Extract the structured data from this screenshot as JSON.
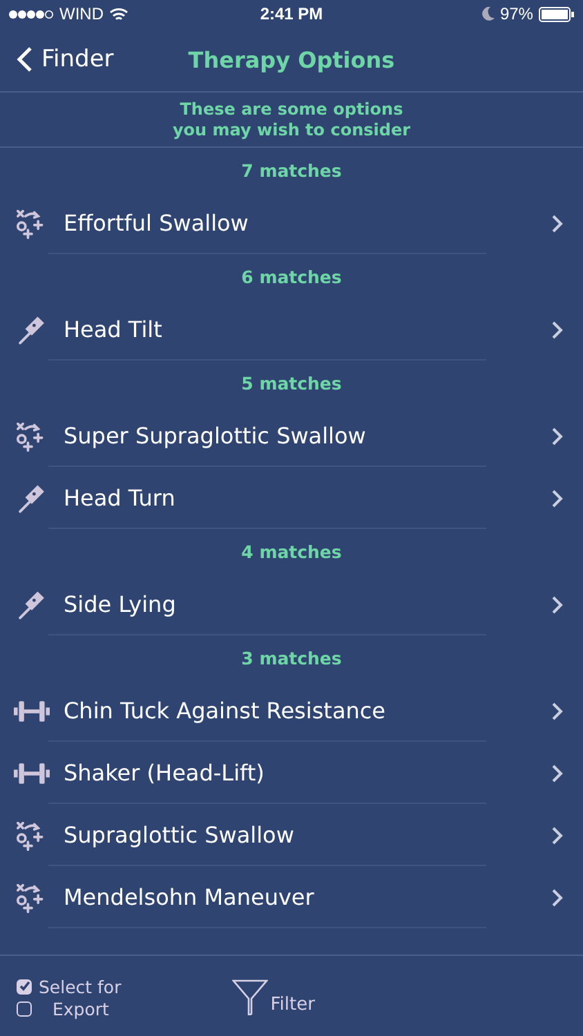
{
  "status_bar": {
    "carrier": "WIND",
    "time": "2:41 PM",
    "battery": "97%"
  },
  "nav": {
    "back": "Finder",
    "title": "Therapy Options"
  },
  "intro": "These are some options\nyou may wish to consider",
  "sections": [
    {
      "header": "7 matches",
      "items": [
        {
          "label": "Effortful Swallow",
          "kind": "maneuver"
        }
      ]
    },
    {
      "header": "6 matches",
      "items": [
        {
          "label": "Head Tilt",
          "kind": "posture"
        }
      ]
    },
    {
      "header": "5 matches",
      "items": [
        {
          "label": "Super Supraglottic Swallow",
          "kind": "maneuver"
        },
        {
          "label": "Head Turn",
          "kind": "posture"
        }
      ]
    },
    {
      "header": "4 matches",
      "items": [
        {
          "label": "Side Lying",
          "kind": "posture"
        }
      ]
    },
    {
      "header": "3 matches",
      "items": [
        {
          "label": "Chin Tuck Against Resistance",
          "kind": "exercise"
        },
        {
          "label": "Shaker (Head-Lift)",
          "kind": "exercise"
        },
        {
          "label": "Supraglottic Swallow",
          "kind": "maneuver"
        },
        {
          "label": "Mendelsohn Maneuver",
          "kind": "maneuver"
        }
      ]
    }
  ],
  "toolbar": {
    "export": [
      {
        "label": "Select for",
        "checked": true
      },
      {
        "label": "Export",
        "checked": false
      }
    ],
    "filter": "Filter"
  }
}
